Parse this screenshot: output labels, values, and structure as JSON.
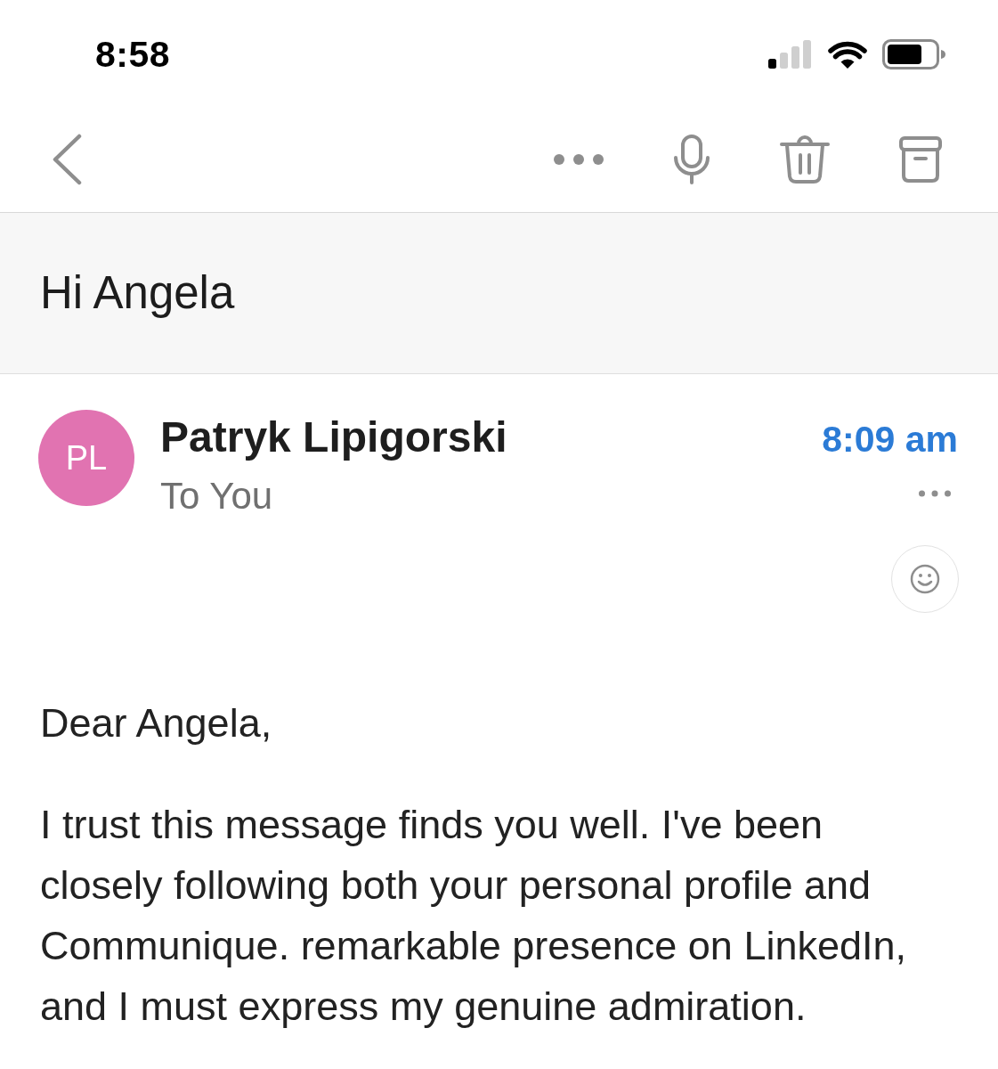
{
  "status_bar": {
    "time": "8:58"
  },
  "subject": {
    "title": "Hi Angela"
  },
  "message": {
    "sender": {
      "initials": "PL",
      "name": "Patryk Lipigorski"
    },
    "recipients": "To You",
    "time": "8:09 am",
    "greeting": "Dear Angela,",
    "paragraphs": [
      "I trust this message finds you well. I've been closely following both your personal profile and Communique. remarkable presence on LinkedIn, and I must express my genuine admiration."
    ]
  }
}
